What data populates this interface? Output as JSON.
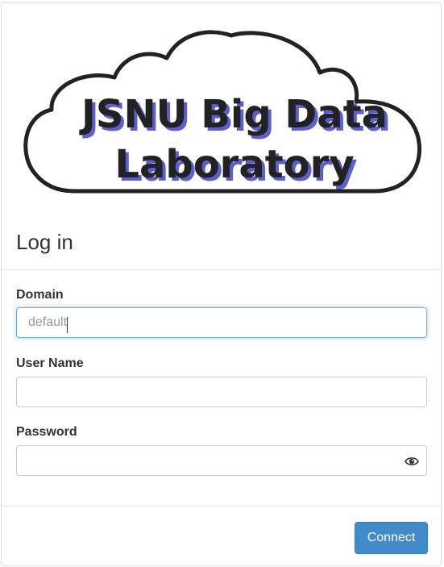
{
  "logo": {
    "line1": "JSNU Big Data",
    "line2": "Laboratory"
  },
  "form": {
    "title": "Log in",
    "domain": {
      "label": "Domain",
      "value": "",
      "placeholder": "default"
    },
    "username": {
      "label": "User Name",
      "value": "",
      "placeholder": ""
    },
    "password": {
      "label": "Password",
      "value": "",
      "placeholder": "",
      "toggle_icon": "eye-icon"
    },
    "connect_label": "Connect"
  },
  "colors": {
    "primary": "#428bca",
    "focus_border": "#66afe9",
    "logo_text_fill": "#222222",
    "logo_text_shadow": "#5a5fd8"
  }
}
